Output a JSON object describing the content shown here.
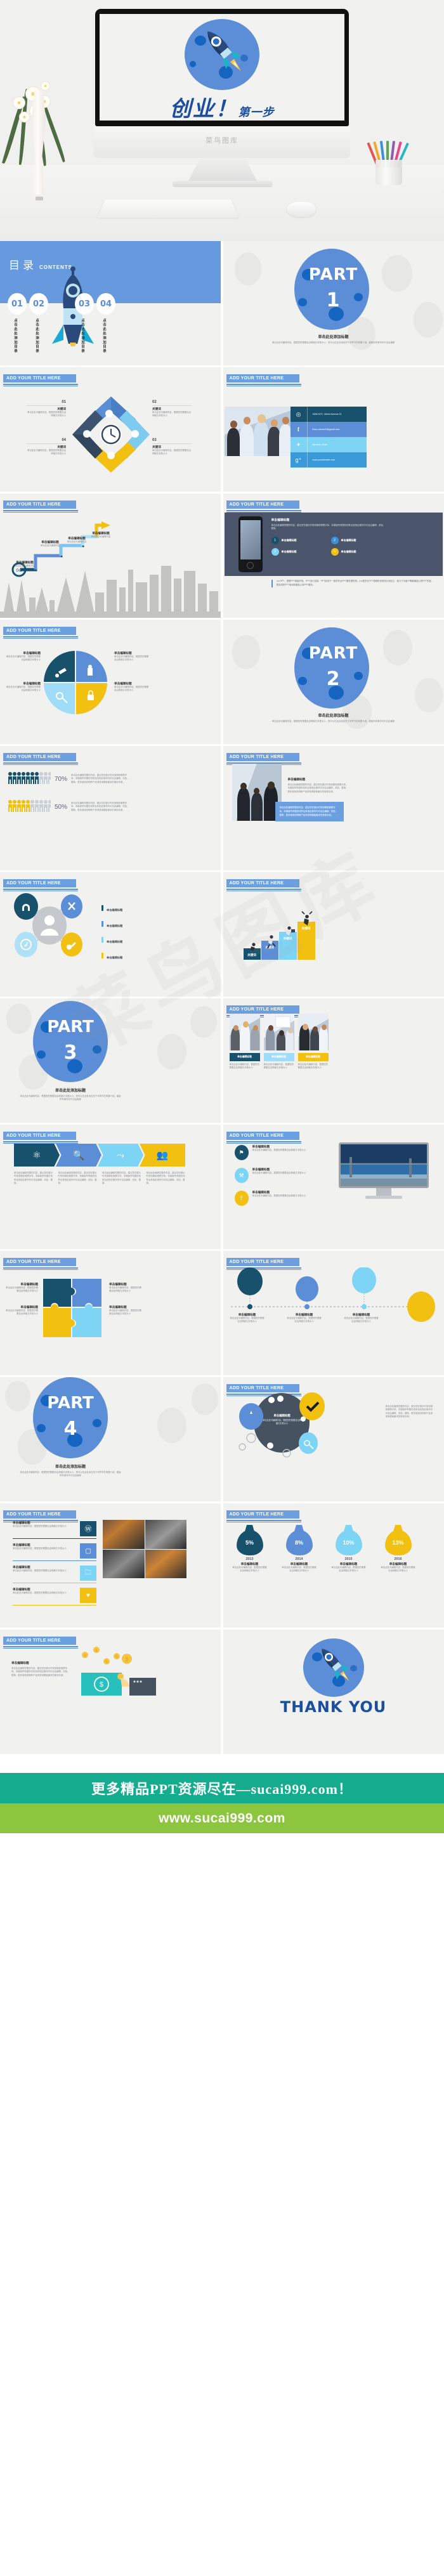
{
  "hero": {
    "title_cn": "创业！",
    "title_sub": "第一步",
    "monitor_brand": "菜鸟图库",
    "icon": "rocket-icon"
  },
  "toc": {
    "title_cn": "目录",
    "title_en": "CONTENTS",
    "items": [
      {
        "num": "01",
        "label": "点击此处添加目录"
      },
      {
        "num": "02",
        "label": "点击此处添加目录"
      },
      {
        "num": "03",
        "label": "点击此处添加目录"
      },
      {
        "num": "04",
        "label": "点击此处添加目录"
      }
    ]
  },
  "common": {
    "slide_title": "ADD YOUR TITLE HERE",
    "section_heading": "单击此处添加标题",
    "section_body": "单击此处可编辑内容，根据您的需要自由伸缩文本框大小、您可以在此处添加关于本章节的简要介绍、模板所有素材均可自由编辑",
    "edit_heading": "单击编辑标题",
    "edit_body": "单击此处可编辑内容，根据您的需要自由伸缩文本框大小",
    "edit_body_long": "单击此处编辑您要的内容，建议您在展示时采用微软雅黑字体、本模版所有图形线条及其相应素材均可自由编辑、改色、替换，更多使用说明和产品请咨询模板最末的使用手册。",
    "keyword": "关键词",
    "keyword_body": "单击此处可编辑内容，根据您的需要自由伸缩文本框大小"
  },
  "parts": [
    {
      "label": "PART",
      "num": "1"
    },
    {
      "label": "PART",
      "num": "2"
    },
    {
      "label": "PART",
      "num": "3"
    },
    {
      "label": "PART",
      "num": "4"
    }
  ],
  "cycle4": {
    "nums": [
      "01",
      "02",
      "03",
      "04"
    ],
    "keyword": "关键词",
    "body": "单击此处可编辑内容，根据您的需要自由伸缩文本框大小",
    "icons": [
      "lungs-icon",
      "bulb-icon",
      "chart-icon",
      "gears-icon"
    ],
    "center_icon": "clock-icon"
  },
  "contact": {
    "rows": [
      {
        "icon": "location-pin-icon",
        "text": "3456 NYC, Street Avenue 21",
        "color": "#17516b"
      },
      {
        "icon": "facebook-icon",
        "text": "tham.nanda19@gmail.com",
        "color": "#5b8ed6"
      },
      {
        "icon": "twitter-icon",
        "text": "@nanda_tham",
        "color": "#7ed4f5"
      },
      {
        "icon": "google-plus-icon",
        "text": "www.yourwebsite.com",
        "color": "#3a9ad9"
      }
    ]
  },
  "roadmap": {
    "start_label": "GO",
    "steps": [
      {
        "title": "单击编辑标题",
        "body": "单击此处可编辑内容"
      },
      {
        "title": "单击编辑标题",
        "body": "单击此处可编辑内容"
      },
      {
        "title": "单击编辑标题",
        "body": "单击此处可编辑内容"
      },
      {
        "title": "单击编辑标题",
        "body": "单击此处可编辑内容"
      }
    ]
  },
  "phone_slide": {
    "heading": "单击编辑标题",
    "body": "单击此处编辑您要的内容，建议您在展示时采用微软雅黑字体、本模版所有图形线条及其相应素材均可自由编辑、改色、替换。",
    "items": [
      {
        "num": "1",
        "label": "单击编辑标题",
        "color": "#17516b"
      },
      {
        "num": "2",
        "label": "单击编辑标题",
        "color": "#3d8fd8"
      },
      {
        "num": "3",
        "label": "单击编辑标题",
        "color": "#7ed4f5"
      },
      {
        "num": "4",
        "label": "单击编辑标题",
        "color": "#f2c011"
      }
    ],
    "footnote": "小a PPT，是做PPT模板开发、PPT设计定制、PPT培训于一体的专业PPT服务提供商。小a是多位PPT领域的资深设计师创立，致力于为客户奉献最用心的PPT作品，是实用的PPT培训和最贴心的PPT服务。"
  },
  "pie4": {
    "quadrants": [
      {
        "title": "单击编辑标题",
        "body": "单击此处可编辑内容，根据您的需要自由伸缩文本框大小",
        "icon": "pin-icon",
        "color": "#17516b"
      },
      {
        "title": "单击编辑标题",
        "body": "单击此处可编辑内容，根据您的需要自由伸缩文本框大小",
        "icon": "thumbs-up-icon",
        "color": "#5b8ed6"
      },
      {
        "title": "单击编辑标题",
        "body": "单击此处可编辑内容，根据您的需要自由伸缩文本框大小",
        "icon": "key-icon",
        "color": "#7ed4f5"
      },
      {
        "title": "单击编辑标题",
        "body": "单击此处可编辑内容，根据您的需要自由伸缩文本框大小",
        "icon": "lock-icon",
        "color": "#f2c011"
      }
    ]
  },
  "chart_data": {
    "type": "bar",
    "title": "",
    "subtitle": "",
    "xlabel": "",
    "ylabel": "",
    "grid": false,
    "legend": "none",
    "charts": [
      {
        "name": "people-pictogram",
        "type": "pictogram",
        "categories": [
          "",
          ""
        ],
        "values": [
          70,
          50
        ],
        "value_labels": [
          "70%",
          "50%"
        ],
        "icons_total": 10,
        "icons_filled": [
          7,
          5
        ],
        "colors": [
          "#17516b",
          "#f2c011"
        ],
        "notes": [
          "单击此处编辑您要的内容，建议您在展示时采用微软雅黑字体、本模版所有图形线条及其相应素材均可自由编辑、改色、替换，更多使用说明和产品请咨询模板最末的使用手册。",
          "单击此处编辑您要的内容，建议您在展示时采用微软雅黑字体、本模版所有图形线条及其相应素材均可自由编辑、改色、替换，更多使用说明和产品请咨询模板最末的使用手册。"
        ]
      },
      {
        "name": "staircase-bars",
        "type": "bar",
        "categories": [
          "关键词",
          "关键词",
          "关键词",
          "关键词"
        ],
        "values": [
          22,
          34,
          46,
          60
        ],
        "colors": [
          "#17516b",
          "#5b8ed6",
          "#7ed4f5",
          "#f2c011"
        ],
        "ylim": [
          0,
          62
        ]
      },
      {
        "name": "money-bags",
        "type": "bar",
        "categories": [
          "2013",
          "2014",
          "2015",
          "2016"
        ],
        "values": [
          5,
          8,
          10,
          13
        ],
        "value_labels": [
          "5%",
          "8%",
          "10%",
          "13%"
        ],
        "colors": [
          "#17516b",
          "#5b8ed6",
          "#7ed4f5",
          "#f2c011"
        ],
        "ylabel": "%",
        "ylim": [
          0,
          15
        ],
        "captions": [
          "单击编辑标题",
          "单击编辑标题",
          "单击编辑标题",
          "单击编辑标题"
        ],
        "caption_bodies": [
          "单击此处可编辑内容，根据您的需要自由伸缩文本框大小",
          "单击此处可编辑内容，根据您的需要自由伸缩文本框大小",
          "单击此处可编辑内容，根据您的需要自由伸缩文本框大小",
          "单击此处可编辑内容，根据您的需要自由伸缩文本框大小"
        ]
      }
    ]
  },
  "person_icons": {
    "legend": [
      {
        "label": "单击编辑标题",
        "color": "#17516b"
      },
      {
        "label": "单击编辑标题",
        "color": "#5b8ed6"
      },
      {
        "label": "单击编辑标题",
        "color": "#7ed4f5"
      },
      {
        "label": "单击编辑标题",
        "color": "#f2c011"
      }
    ],
    "icons": [
      "headphone-icon",
      "tools-icon",
      "compass-icon",
      "rocket-icon"
    ],
    "center_icon": "user-icon"
  },
  "team3": {
    "cards": [
      {
        "title": "单击编辑标题",
        "body": "单击此处可编辑内容，根据您的需要自由伸缩文本框大小",
        "color": "#17516b"
      },
      {
        "title": "单击编辑标题",
        "body": "单击此处可编辑内容，根据您的需要自由伸缩文本框大小",
        "color": "#7ed4f5"
      },
      {
        "title": "单击编辑标题",
        "body": "单击此处可编辑内容，根据您的需要自由伸缩文本框大小",
        "color": "#f2c011"
      }
    ]
  },
  "ribbon4": {
    "icons": [
      "molecule-icon",
      "search-icon",
      "share-icon",
      "group-icon"
    ],
    "colors": [
      "#17516b",
      "#5b8ed6",
      "#7ed4f5",
      "#f2c011"
    ],
    "bodies": [
      "单击此处编辑您要的内容，建议您在展示时采用微软雅黑字体，本模版所有图形线条及其相应素材均可自由编辑、改色、替换。",
      "单击此处编辑您要的内容，建议您在展示时采用微软雅黑字体，本模版所有图形线条及其相应素材均可自由编辑、改色、替换。",
      "单击此处编辑您要的内容，建议您在展示时采用微软雅黑字体，本模版所有图形线条及其相应素材均可自由编辑、改色、替换。",
      "单击此处编辑您要的内容，建议您在展示时采用微软雅黑字体，本模版所有图形线条及其相应素材均可自由编辑、改色、替换。"
    ]
  },
  "monitor_slide": {
    "items": [
      {
        "icon": "flag-icon",
        "title": "单击编辑标题",
        "body": "单击此处可编辑内容，根据您的需要自由伸缩文本框大小",
        "color": "#17516b"
      },
      {
        "icon": "tools-icon",
        "title": "单击编辑标题",
        "body": "单击此处可编辑内容，根据您的需要自由伸缩文本框大小",
        "color": "#7ed4f5"
      },
      {
        "icon": "upload-icon",
        "title": "单击编辑标题",
        "body": "单击此处可编辑内容，根据您的需要自由伸缩文本框大小",
        "color": "#f2c011"
      }
    ]
  },
  "puzzle": {
    "pieces": [
      {
        "title": "单击编辑标题",
        "body": "单击此处可编辑内容，根据您的需要自由伸缩文本框大小",
        "color": "#17516b"
      },
      {
        "title": "单击编辑标题",
        "body": "单击此处可编辑内容，根据您的需要自由伸缩文本框大小",
        "color": "#5b8ed6"
      },
      {
        "title": "单击编辑标题",
        "body": "单击此处可编辑内容，根据您的需要自由伸缩文本框大小",
        "color": "#f2c011"
      },
      {
        "title": "单击编辑标题",
        "body": "单击此处可编辑内容，根据您的需要自由伸缩文本框大小",
        "color": "#7ed4f5"
      }
    ]
  },
  "timeline": {
    "nodes": [
      {
        "title": "单击编辑标题",
        "body": "单击此处可编辑内容，根据您的需要自由伸缩文本框大小",
        "color": "#17516b"
      },
      {
        "title": "单击编辑标题",
        "body": "单击此处可编辑内容，根据您的需要自由伸缩文本框大小",
        "color": "#5b8ed6"
      },
      {
        "title": "单击编辑标题",
        "body": "单击此处可编辑内容，根据您的需要自由伸缩文本框大小",
        "color": "#7ed4f5"
      },
      {
        "title": "",
        "body": "",
        "color": "#f2c011"
      }
    ]
  },
  "bubble_slide": {
    "center_title": "单击编辑标题",
    "center_body": "单击此处可编辑内容，根据您的需要自由伸缩文本框大小",
    "body": "单击此处编辑您要的内容，建议您在展示时采用微软雅黑字体，本模版所有图形线条及其相应素材均可自由编辑、改色、替换，更多使用说明和产品请咨询模板最末的使用手册。",
    "badges": [
      "check-icon",
      "key-icon",
      "flag-icon"
    ]
  },
  "list4": {
    "items": [
      {
        "icon": "wordpress-icon",
        "title": "单击编辑标题",
        "body": "单击此处可编辑内容，根据您的需要自由伸缩文本框大小",
        "color": "#17516b"
      },
      {
        "icon": "tablet-icon",
        "title": "单击编辑标题",
        "body": "单击此处可编辑内容，根据您的需要自由伸缩文本框大小",
        "color": "#5b8ed6"
      },
      {
        "icon": "briefcase-icon",
        "title": "单击编辑标题",
        "body": "单击此处可编辑内容，根据您的需要自由伸缩文本框大小",
        "color": "#7ed4f5"
      },
      {
        "icon": "heart-icon",
        "title": "单击编辑标题",
        "body": "单击此处可编辑内容，根据您的需要自由伸缩文本框大小",
        "color": "#f2c011"
      }
    ]
  },
  "money_slide": {
    "heading": "单击编辑标题",
    "body": "单击此处编辑您要的内容，建议您在展示时采用微软雅黑字体、本模版所有图形线条及其相应素材均可自由编辑、改色、替换，更多使用说明和产品请咨询模板最末的使用手册。",
    "icon": "cash-hand-icon"
  },
  "thankyou": {
    "text": "THANK YOU",
    "icon": "rocket-icon"
  },
  "footer": {
    "line1": "更多精品PPT资源尽在—sucai999.com！",
    "line2": "www.sucai999.com",
    "color1": "#14ab8e",
    "color2": "#8cc63e"
  },
  "watermark": "菜鸟图库",
  "palette": {
    "blue": "#5b8ed6",
    "title_blue": "#6c9fe0",
    "dark_teal": "#17516b",
    "light_blue": "#7ed4f5",
    "yellow": "#f2c011",
    "slide_bg": "#f1f1f0"
  }
}
